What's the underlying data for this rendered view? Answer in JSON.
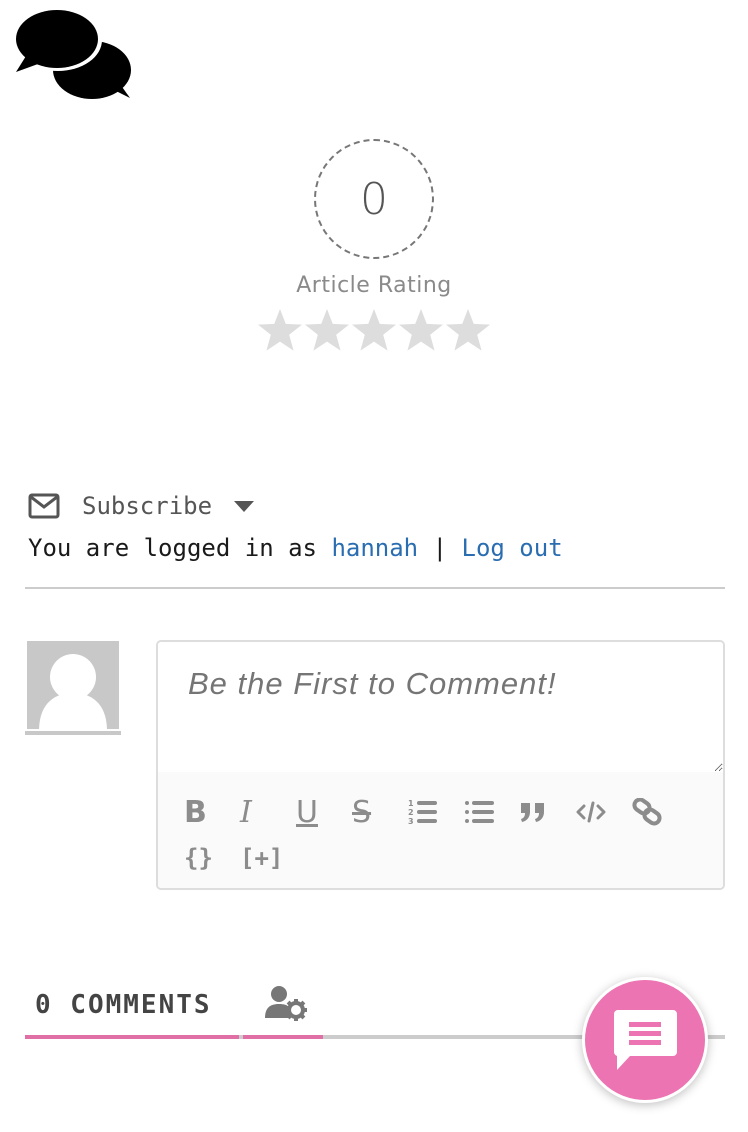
{
  "logo": {
    "icon": "comments-icon"
  },
  "rating": {
    "value": "0",
    "label": "Article Rating",
    "stars_total": 5,
    "stars_filled": 0,
    "star_color": "#dddddd"
  },
  "subscribe": {
    "icon": "envelope-icon",
    "label": "Subscribe",
    "caret_icon": "caret-down-icon"
  },
  "login": {
    "prefix": "You are logged in as ",
    "username": "hannah",
    "separator": " | ",
    "logout_label": "Log out",
    "link_color": "#2a6db0"
  },
  "editor": {
    "placeholder": "Be the First to Comment!",
    "toolbar": {
      "row1": [
        {
          "name": "bold",
          "label": "B"
        },
        {
          "name": "italic",
          "label": "I"
        },
        {
          "name": "underline",
          "label": "U"
        },
        {
          "name": "strikethrough",
          "label": "S"
        },
        {
          "name": "ordered-list",
          "label": ""
        },
        {
          "name": "bullet-list",
          "label": ""
        },
        {
          "name": "blockquote",
          "label": ""
        },
        {
          "name": "code",
          "label": ""
        },
        {
          "name": "link",
          "label": ""
        }
      ],
      "row2": [
        {
          "name": "source-code",
          "label": "{}"
        },
        {
          "name": "spoiler",
          "label": "[+]"
        }
      ]
    }
  },
  "tabs": {
    "comments_label": "0 COMMENTS",
    "settings_icon": "user-gear-icon",
    "accent_color": "#e06fa6"
  },
  "fab": {
    "icon": "comment-lines-icon",
    "color": "#ec74b2"
  }
}
